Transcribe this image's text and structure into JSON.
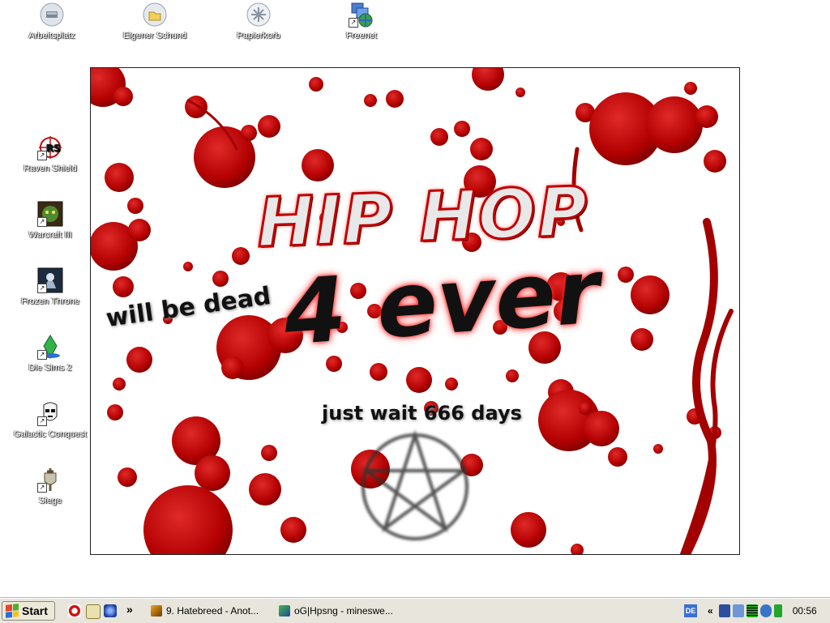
{
  "desktop": {
    "icons_top": [
      {
        "label": "Arbeitsplatz",
        "icon": "my-computer-icon"
      },
      {
        "label": "Eigener Schund",
        "icon": "my-documents-icon"
      },
      {
        "label": "Papierkorb",
        "icon": "recycle-bin-icon"
      },
      {
        "label": "Freenet",
        "icon": "network-globe-icon"
      }
    ],
    "icons_left": [
      {
        "label": "Raven Shield",
        "icon": "raven-shield-icon"
      },
      {
        "label": "Warcraft III",
        "icon": "warcraft-icon"
      },
      {
        "label": "Frozen Throne",
        "icon": "frozen-throne-icon"
      },
      {
        "label": "Die Sims 2",
        "icon": "sims-plumbob-icon"
      },
      {
        "label": "Galactic Conquest",
        "icon": "stormtrooper-icon"
      },
      {
        "label": "Siege",
        "icon": "knight-icon"
      }
    ]
  },
  "wallpaper": {
    "line1": "HIP HOP",
    "line2": "4 ever",
    "line3": "will be dead",
    "line4": "just wait 666 days"
  },
  "taskbar": {
    "start_label": "Start",
    "quick_launch_more": "»",
    "tasks": [
      {
        "label": "9. Hatebreed - Anot..."
      },
      {
        "label": "oG|Hpsng - mineswe..."
      }
    ],
    "tray": {
      "lang": "DE",
      "expand": "«",
      "clock": "00:56"
    }
  },
  "colors": {
    "blood": "#b30000",
    "taskbar": "#e8e6dc"
  }
}
